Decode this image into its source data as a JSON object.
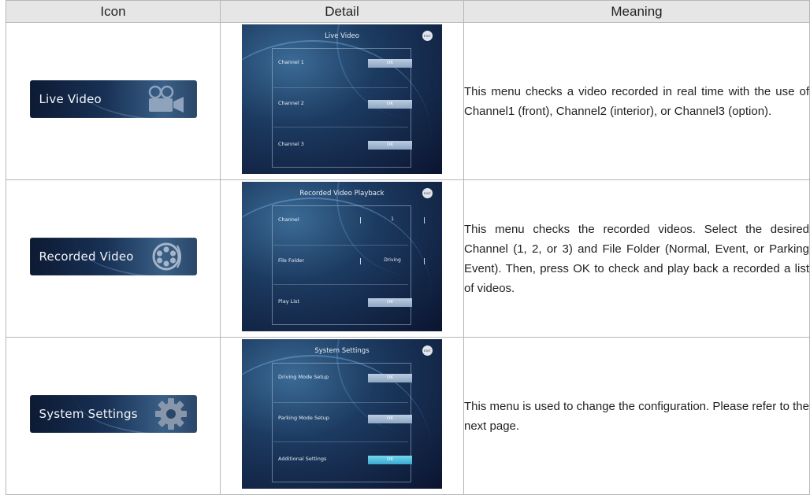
{
  "header": {
    "icon": "Icon",
    "detail": "Detail",
    "meaning": "Meaning"
  },
  "rows": [
    {
      "icon_label": "Live Video",
      "icon_glyph": "video-camera-icon",
      "detail": {
        "title": "Live Video",
        "exit": "EXIT",
        "items": [
          {
            "label": "Channel 1",
            "button": "OK"
          },
          {
            "label": "Channel 2",
            "button": "OK"
          },
          {
            "label": "Channel 3",
            "button": "OK"
          }
        ]
      },
      "meaning": "This menu checks a video recorded in real time with the use of Channel1 (front), Channel2 (interior), or Channel3 (option)."
    },
    {
      "icon_label": "Recorded Video",
      "icon_glyph": "film-reel-icon",
      "detail": {
        "title": "Recorded Video Playback",
        "exit": "EXIT",
        "items": [
          {
            "label": "Channel",
            "value": "1"
          },
          {
            "label": "File Folder",
            "value": "Driving"
          },
          {
            "label": "Play List",
            "button": "OK"
          }
        ]
      },
      "meaning": "This menu checks the recorded videos. Select the desired Channel (1, 2, or 3) and File Folder (Normal, Event, or Parking Event). Then, press OK to check and play back a recorded a list of videos."
    },
    {
      "icon_label": "System Settings",
      "icon_glyph": "gear-icon",
      "detail": {
        "title": "System Settings",
        "exit": "EXIT",
        "items": [
          {
            "label": "Driving Mode Setup",
            "button": "OK"
          },
          {
            "label": "Parking Mode Setup",
            "button": "OK"
          },
          {
            "label": "Additional Settings",
            "button": "OK"
          }
        ]
      },
      "meaning": "This menu is used to change the configuration. Please refer to the next page."
    }
  ],
  "colors": {
    "header_bg": "#e6e6e6",
    "border": "#b7b7b7",
    "banner_dark": "#0d1a33",
    "ok_highlight": "#3aa9d1"
  }
}
